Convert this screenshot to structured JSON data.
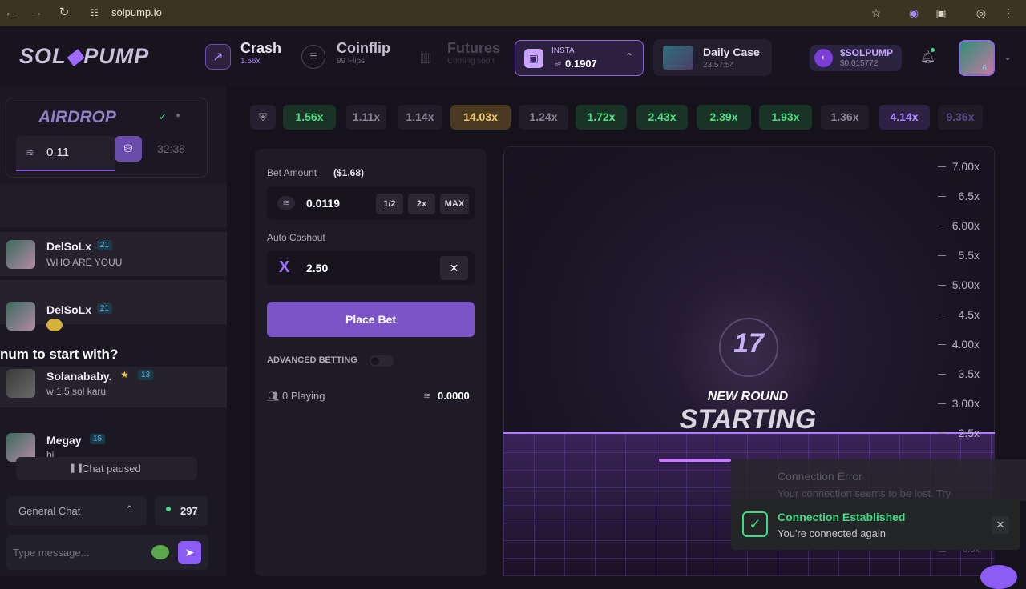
{
  "browser": {
    "url": "solpump.io"
  },
  "brand": {
    "logo_left": "SOL",
    "logo_right": "PUMP"
  },
  "nav": {
    "crash": {
      "title": "Crash",
      "sub": "1.56x"
    },
    "coinflip": {
      "title": "Coinflip",
      "sub": "99 Flips"
    },
    "futures": {
      "title": "Futures",
      "sub": "Coming soon"
    },
    "wallet": {
      "label": "INSTA",
      "amount": "0.1907"
    },
    "daily_case": {
      "title": "Daily Case",
      "timer": "23:57:54"
    },
    "token": {
      "title": "$SOLPUMP",
      "price": "$0.015772"
    },
    "avatar_level": "6"
  },
  "sidebar": {
    "airdrop": {
      "title": "AIRDROP",
      "amount": "0.11",
      "timer": "32:38"
    },
    "messages": [
      {
        "name": "DelSoLx",
        "level": "21",
        "text": "WHO ARE YOUU"
      },
      {
        "name": "DelSoLx",
        "level": "21",
        "text": ""
      },
      {
        "name": "Solanababy.",
        "level": "13",
        "text": "w 1.5 sol karu"
      },
      {
        "name": "Megay",
        "level": "15",
        "text": "hi"
      }
    ],
    "floating_text": "num to start with?",
    "chat_paused": "Chat paused",
    "channel": "General Chat",
    "online": "297",
    "input_placeholder": "Type message..."
  },
  "ticker": [
    "1.56x",
    "1.11x",
    "1.14x",
    "14.03x",
    "1.24x",
    "1.72x",
    "2.43x",
    "2.39x",
    "1.93x",
    "1.36x",
    "4.14x",
    "9.36x"
  ],
  "bet": {
    "amount_label": "Bet Amount",
    "amount_usd": "($1.68)",
    "amount": "0.0119",
    "half": "1/2",
    "double": "2x",
    "max": "MAX",
    "cashout_label": "Auto Cashout",
    "cashout": "2.50",
    "place_bet": "Place Bet",
    "advanced": "ADVANCED BETTING",
    "playing": "0 Playing",
    "total": "0.0000"
  },
  "game": {
    "countdown": "17",
    "line1": "NEW ROUND",
    "line2": "STARTING",
    "y_labels": [
      "7.00x",
      "6.5x",
      "6.00x",
      "5.5x",
      "5.00x",
      "4.5x",
      "4.00x",
      "3.5x",
      "3.00x",
      "2.5x",
      "0.5x"
    ]
  },
  "toasts": {
    "error_title": "Connection Error",
    "error_text": "Your connection seems to be lost. Try",
    "ok_title": "Connection Established",
    "ok_text": "You're connected again"
  }
}
